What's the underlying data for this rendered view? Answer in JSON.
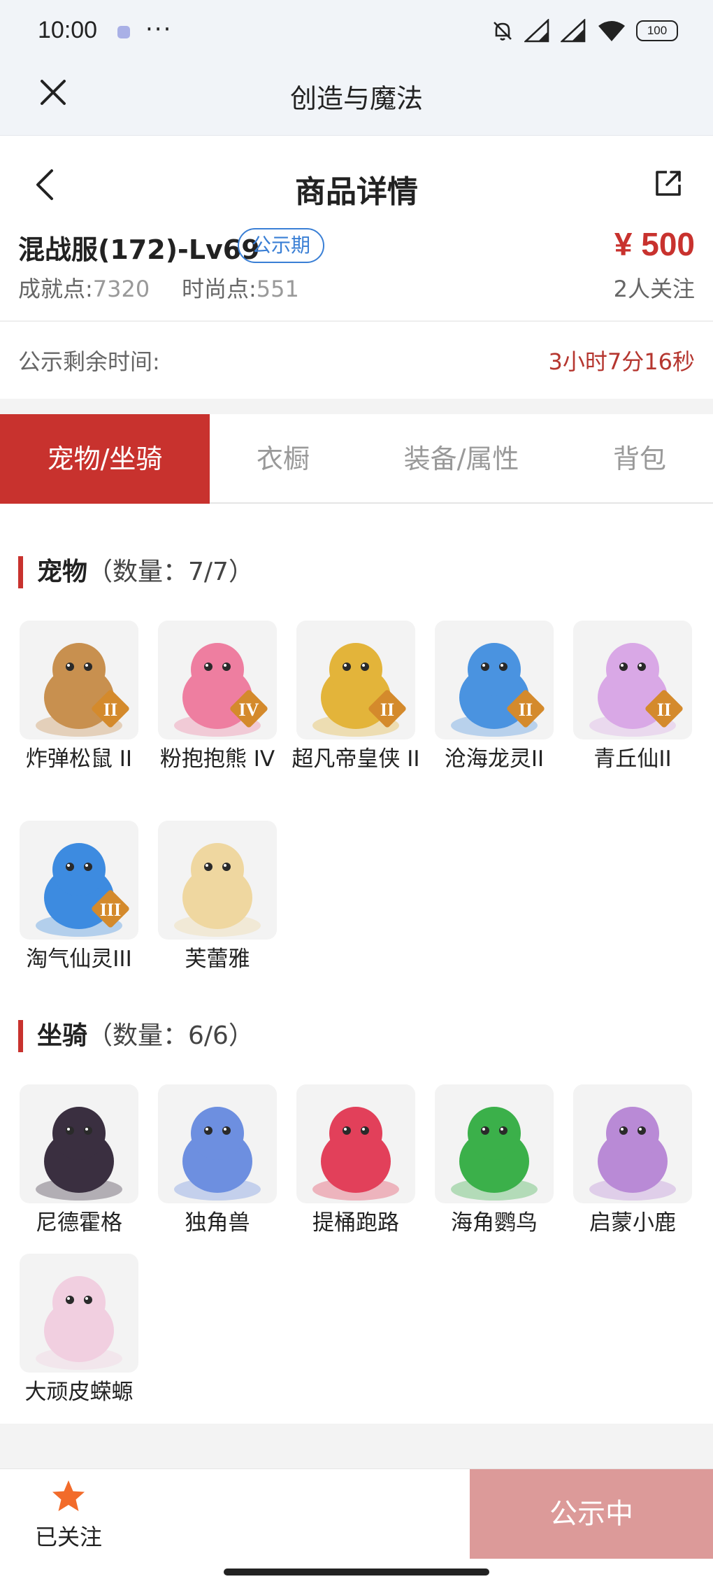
{
  "status_bar": {
    "time": "10:00",
    "more": "···",
    "battery": "100",
    "icons": [
      "app-icon",
      "bell-off-icon",
      "signal-icon",
      "signal-icon",
      "wifi-icon",
      "battery-icon"
    ]
  },
  "app_bar": {
    "title": "创造与魔法",
    "close_icon": "close-icon"
  },
  "page_header": {
    "title": "商品详情",
    "back_icon": "chevron-left-icon",
    "share_icon": "share-icon"
  },
  "summary": {
    "name": "混战服(172)-Lv69",
    "badge": "公示期",
    "achievement_label": "成就点:",
    "achievement_value": "7320",
    "fashion_label": "时尚点:",
    "fashion_value": "551",
    "price": "¥ 500",
    "follows": "2人关注"
  },
  "countdown": {
    "label": "公示剩余时间:",
    "value": "3小时7分16秒"
  },
  "tabs": [
    {
      "label": "宠物/坐骑",
      "active": true
    },
    {
      "label": "衣橱",
      "active": false
    },
    {
      "label": "装备/属性",
      "active": false
    },
    {
      "label": "背包",
      "active": false
    }
  ],
  "pets": {
    "title": "宠物",
    "count": "（数量：7/7）",
    "items": [
      {
        "name": "炸弹松鼠 II",
        "rank": "II",
        "color": "#c8904f"
      },
      {
        "name": "粉抱抱熊 IV",
        "rank": "IV",
        "color": "#ee7ea0"
      },
      {
        "name": "超凡帝皇侠 II",
        "rank": "II",
        "color": "#e3b43a"
      },
      {
        "name": "沧海龙灵II",
        "rank": "II",
        "color": "#4a93e0"
      },
      {
        "name": "青丘仙II",
        "rank": "II",
        "color": "#d9a8e6"
      },
      {
        "name": "淘气仙灵III",
        "rank": "III",
        "color": "#3d8be0"
      },
      {
        "name": "芙蕾雅",
        "rank": "",
        "color": "#efd7a0"
      }
    ]
  },
  "mounts": {
    "title": "坐骑",
    "count": "（数量：6/6）",
    "items": [
      {
        "name": "尼德霍格",
        "color": "#3a2f40"
      },
      {
        "name": "独角兽",
        "color": "#6d8fe0"
      },
      {
        "name": "提桶跑路",
        "color": "#e2405a"
      },
      {
        "name": "海角鹦鸟",
        "color": "#3bb04a"
      },
      {
        "name": "启蒙小鹿",
        "color": "#b98ad6"
      },
      {
        "name": "大顽皮蝾螈",
        "color": "#f1cfe0"
      }
    ]
  },
  "bottom_bar": {
    "favorite_label": "已关注",
    "cta_label": "公示中",
    "accent": "#f26b2a"
  }
}
